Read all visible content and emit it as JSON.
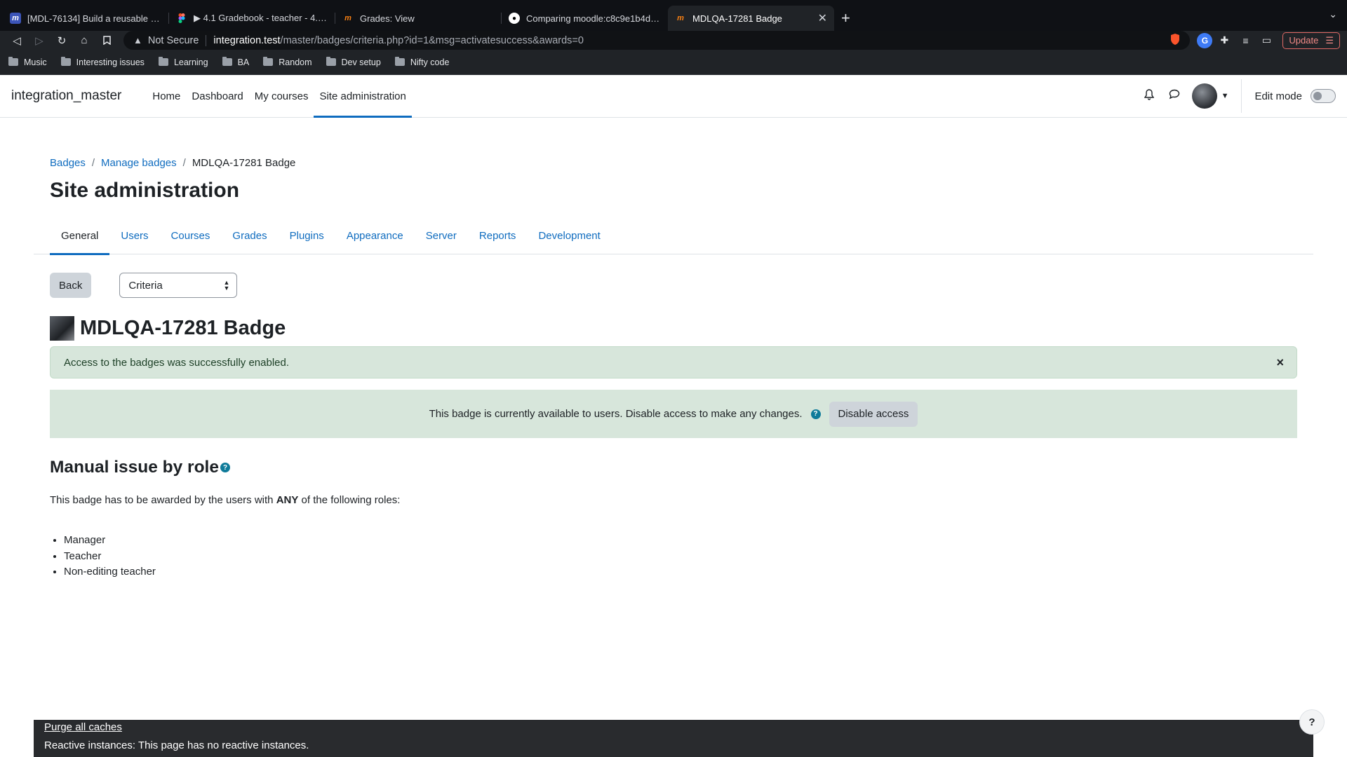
{
  "browser": {
    "tabs": [
      {
        "title": "[MDL-76134] Build a reusable filter",
        "favicon": "moodle-tracker-icon",
        "active": false
      },
      {
        "title": "▶ 4.1 Gradebook - teacher - 4.1 Gra",
        "favicon": "figma-icon",
        "active": false
      },
      {
        "title": "Grades: View",
        "favicon": "moodle-icon",
        "active": false
      },
      {
        "title": "Comparing moodle:c8c9e1b4d033e",
        "favicon": "github-icon",
        "active": false
      },
      {
        "title": "MDLQA-17281 Badge",
        "favicon": "moodle-icon",
        "active": true
      }
    ],
    "address": {
      "security": "Not Secure",
      "host": "integration.test",
      "path": "/master/badges/criteria.php?id=1&msg=activatesuccess&awards=0"
    },
    "update_label": "Update",
    "bookmarks": [
      "Music",
      "Interesting issues",
      "Learning",
      "BA",
      "Random",
      "Dev setup",
      "Nifty code"
    ]
  },
  "navbar": {
    "brand": "integration_master",
    "items": [
      "Home",
      "Dashboard",
      "My courses",
      "Site administration"
    ],
    "active": "Site administration",
    "edit_mode_label": "Edit mode"
  },
  "breadcrumb": [
    "Badges",
    "Manage badges",
    "MDLQA-17281 Badge"
  ],
  "page_title": "Site administration",
  "secondary_nav": [
    "General",
    "Users",
    "Courses",
    "Grades",
    "Plugins",
    "Appearance",
    "Server",
    "Reports",
    "Development"
  ],
  "actions": {
    "back_label": "Back",
    "select_value": "Criteria"
  },
  "badge": {
    "name": "MDLQA-17281 Badge"
  },
  "alert": {
    "message": "Access to the badges was successfully enabled.",
    "close": "×"
  },
  "status": {
    "message": "This badge is currently available to users. Disable access to make any changes.",
    "button_label": "Disable access"
  },
  "criteria": {
    "heading": "Manual issue by role",
    "desc_before": "This badge has to be awarded by the users with ",
    "desc_strong": "ANY",
    "desc_after": " of the following roles:",
    "roles": [
      "Manager",
      "Teacher",
      "Non-editing teacher"
    ]
  },
  "footer": {
    "purge_label": "Purge all caches",
    "reactive_text": "Reactive instances: This page has no reactive instances.",
    "help_label": "?"
  },
  "colors": {
    "primary": "#0f6cbf",
    "success_bg": "#d7e6db",
    "footer_bg": "#292b2e"
  }
}
